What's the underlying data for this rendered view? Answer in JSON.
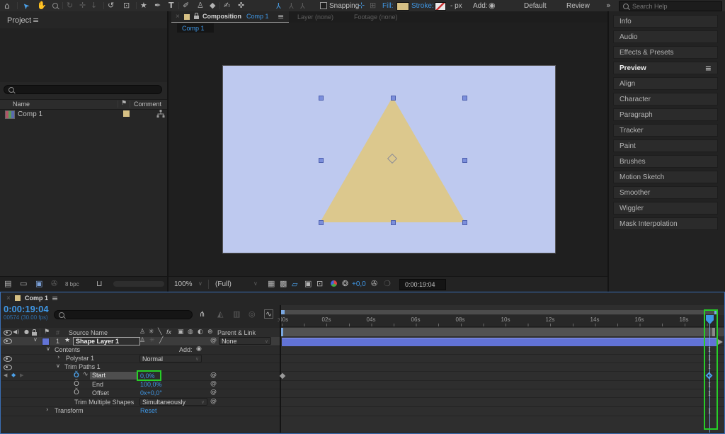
{
  "colors": {
    "accent_blue": "#3f97e5",
    "comp_bg": "#bec9ef",
    "shape_fill": "#dcc88d",
    "highlight_green": "#27ce27",
    "layer_bar": "#6273d6",
    "fill_swatch": "#d6c084"
  },
  "icons": {
    "close": "×",
    "menu": "≡",
    "caret": "∨",
    "chev_right": "›",
    "chev_down": "∨",
    "star": "★",
    "pickwhip": "@",
    "add_circle": "◉",
    "kf_prev": "◀",
    "kf_diamond": "◆",
    "kf_next": "▶",
    "stopwatch": "Ŏ",
    "graph": "∿",
    "flag": "⚑",
    "speaker": "◀)",
    "solo": "●",
    "hash": "#",
    "ibeam": "I",
    "overflow": "»",
    "rgb": "",
    "aperture": "❂",
    "camera": "✇",
    "snapshot": "❍",
    "flowchart": "⋔",
    "draft3d": "◭",
    "frameblend": "▥",
    "motionblur": "◎",
    "grapheditor": "∿",
    "grid": "▦",
    "transparency": "▩",
    "maskvis": "▱",
    "roi": "▣",
    "safe": "⊡",
    "film": "▤",
    "folder": "▭",
    "compicon": "▣",
    "depth": "✇",
    "trash": "⊔",
    "shy": "♙",
    "collapse": "✳",
    "quality_hdr": "╲",
    "fx": "fx",
    "adjust": "▣",
    "ball": "◍",
    "threed": "◐",
    "sphere": "⊕",
    "quality_layer": "╱",
    "axis": "Y",
    "snap1": "⊹",
    "snap2": "⊞"
  },
  "toolbar": {
    "tools": [
      {
        "name": "home",
        "glyph": "⌂"
      },
      {
        "name": "selection-tool",
        "glyph": "➤"
      },
      {
        "name": "hand-tool",
        "glyph": "✋"
      },
      {
        "name": "zoom-tool",
        "glyph": ""
      },
      {
        "name": "orbit-camera-tool",
        "glyph": "↻"
      },
      {
        "name": "pan-camera-tool",
        "glyph": "✛"
      },
      {
        "name": "dolly-camera-tool",
        "glyph": "↓"
      },
      {
        "name": "rotation-tool",
        "glyph": "↺"
      },
      {
        "name": "pan-behind-tool",
        "glyph": "⊡"
      },
      {
        "name": "shape-tool",
        "glyph": "★"
      },
      {
        "name": "pen-tool",
        "glyph": "✒"
      },
      {
        "name": "type-tool",
        "glyph": "T"
      },
      {
        "name": "brush-tool",
        "glyph": "✐"
      },
      {
        "name": "clone-stamp-tool",
        "glyph": "♙"
      },
      {
        "name": "eraser-tool",
        "glyph": "◆"
      },
      {
        "name": "roto-brush-tool",
        "glyph": "✍"
      },
      {
        "name": "puppet-pin-tool",
        "glyph": "✜"
      }
    ],
    "snapping_label": "Snapping",
    "fill_label": "Fill:",
    "stroke_label": "Stroke:",
    "stroke_value": "-",
    "stroke_unit": "px",
    "add_label": "Add:",
    "workspace_default": "Default",
    "workspace_review": "Review",
    "search_placeholder": "Search Help"
  },
  "project": {
    "tab_label": "Project",
    "col_name": "Name",
    "col_comment": "Comment",
    "item_name": "Comp 1",
    "bit_depth": "8 bpc"
  },
  "viewer": {
    "tab_composition": "Composition",
    "tab_comp_name": "Comp 1",
    "tab_layer": "Layer (none)",
    "tab_footage": "Footage (none)",
    "subtab": "Comp 1",
    "zoom_level": "100%",
    "resolution": "(Full)",
    "exposure": "+0,0",
    "timecode": "0:00:19:04"
  },
  "panels": {
    "items": [
      "Info",
      "Audio",
      "Effects & Presets",
      "Preview",
      "Align",
      "Character",
      "Paragraph",
      "Tracker",
      "Paint",
      "Brushes",
      "Motion Sketch",
      "Smoother",
      "Wiggler",
      "Mask Interpolation"
    ],
    "active": "Preview"
  },
  "timeline": {
    "tab": "Comp 1",
    "timecode": "0:00:19:04",
    "frame_info": "00574 (30.00 fps)",
    "col_number": "#",
    "col_source": "Source Name",
    "col_parent": "Parent & Link",
    "layer": {
      "number": "1",
      "name": "Shape Layer 1",
      "parent_value": "None"
    },
    "contents_label": "Contents",
    "add_label": "Add:",
    "polystar": {
      "label": "Polystar 1",
      "blend_mode": "Normal"
    },
    "trim_paths": {
      "label": "Trim Paths 1",
      "start_label": "Start",
      "start_value": "0,0%",
      "end_label": "End",
      "end_value": "100,0%",
      "offset_label": "Offset",
      "offset_value": "0x+0,0°",
      "tms_label": "Trim Multiple Shapes",
      "tms_value": "Simultaneously"
    },
    "transform_label": "Transform",
    "reset_label": "Reset",
    "ruler": [
      ":00s",
      "02s",
      "04s",
      "06s",
      "08s",
      "10s",
      "12s",
      "14s",
      "16s",
      "18s"
    ]
  }
}
